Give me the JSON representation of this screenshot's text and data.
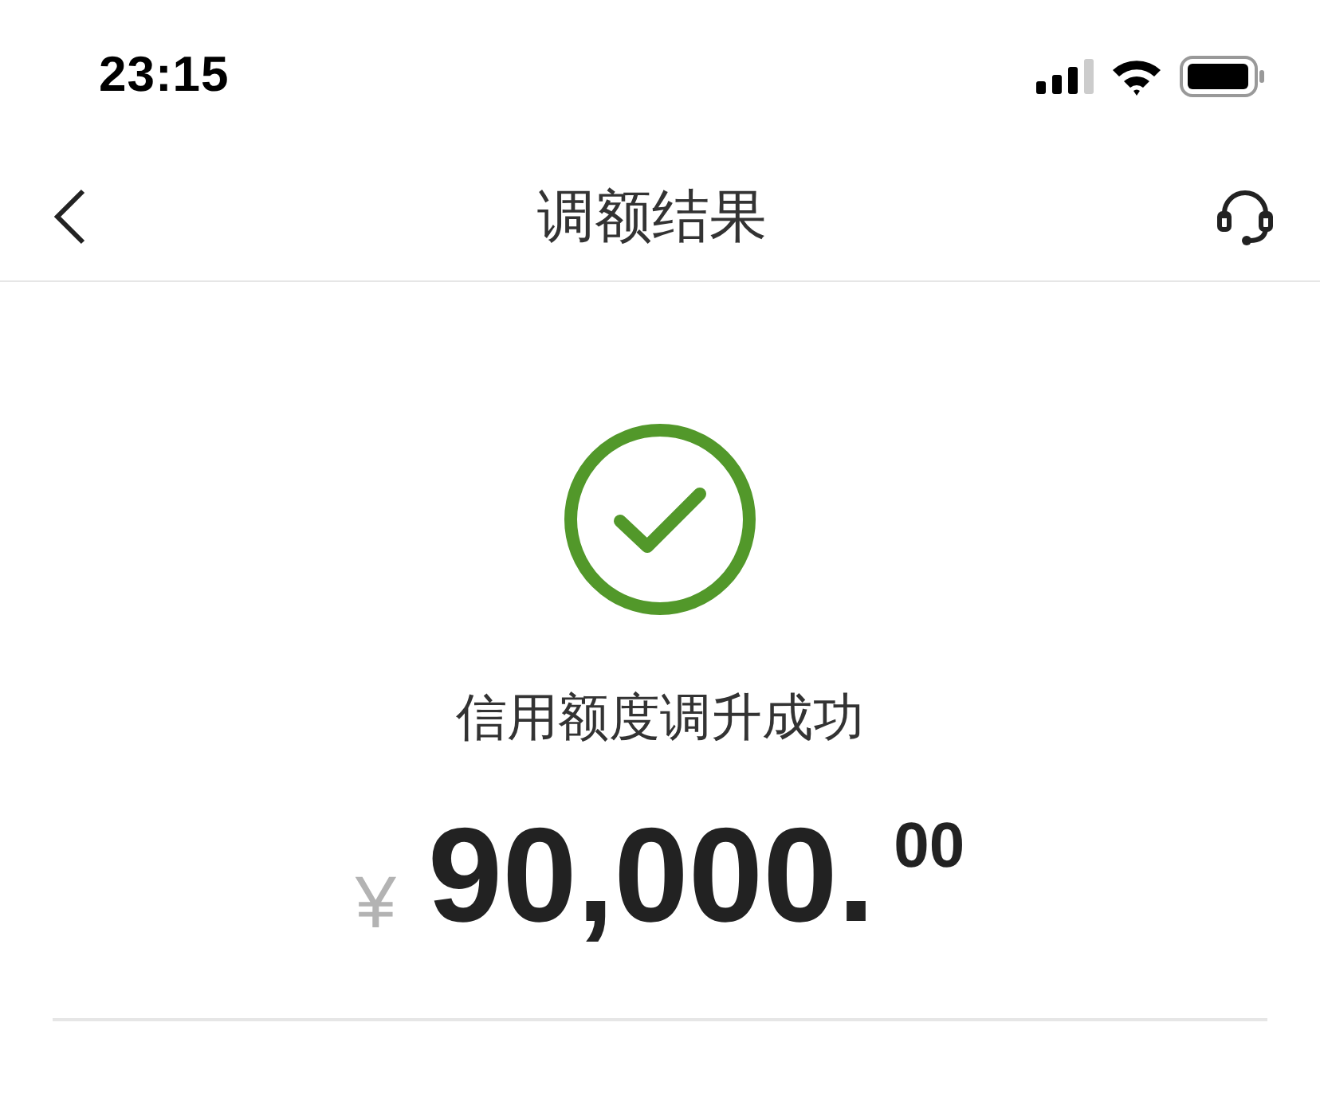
{
  "status_bar": {
    "time": "23:15"
  },
  "nav_bar": {
    "title": "调额结果"
  },
  "result": {
    "success": true,
    "message": "信用额度调升成功",
    "amount": {
      "currency": "¥",
      "integer": "90,000.",
      "decimals": "00"
    }
  }
}
